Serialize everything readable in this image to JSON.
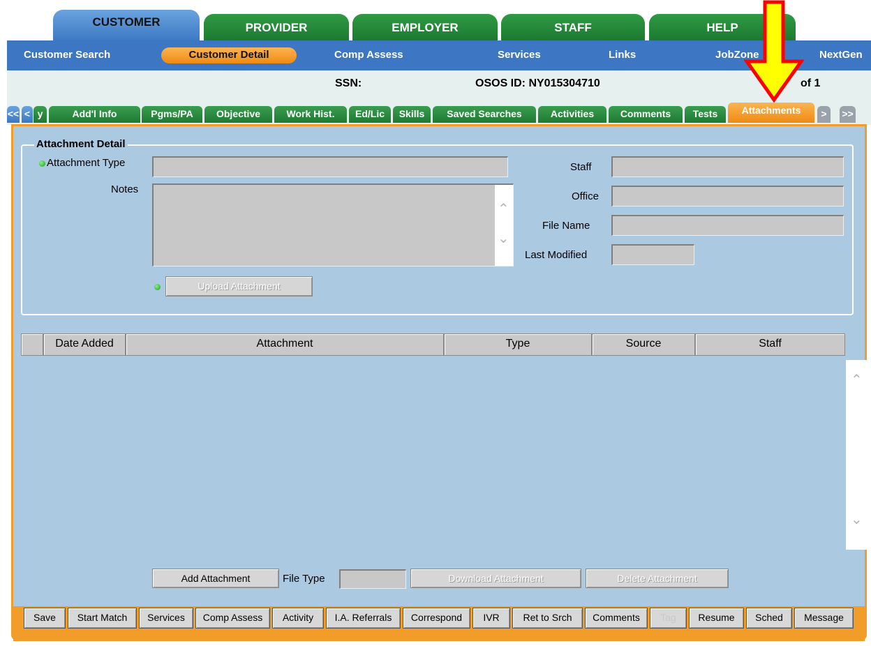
{
  "module_tabs": [
    "CUSTOMER",
    "PROVIDER",
    "EMPLOYER",
    "STAFF",
    "HELP"
  ],
  "subnav": {
    "items": [
      "Customer Search",
      "Customer Detail",
      "Comp Assess",
      "Services",
      "Links",
      "JobZone",
      "NextGen"
    ],
    "active": "Customer Detail"
  },
  "info": {
    "ssn_label": "SSN:",
    "osos_label": "OSOS ID: NY015304710",
    "of_label": "of 1"
  },
  "detail_tabs": {
    "nav_first": "<<",
    "nav_prev": "<",
    "partial": "y",
    "tabs": [
      "Add'l Info",
      "Pgms/PA",
      "Objective",
      "Work Hist.",
      "Ed/Lic",
      "Skills",
      "Saved Searches",
      "Activities",
      "Comments",
      "Tests",
      "Attachments"
    ],
    "active": "Attachments",
    "nav_next": ">",
    "nav_last": ">>"
  },
  "attachment_detail": {
    "legend": "Attachment Detail",
    "type_label": "Attachment Type",
    "notes_label": "Notes",
    "staff_label": "Staff",
    "office_label": "Office",
    "file_name_label": "File Name",
    "last_modified_label": "Last Modified",
    "upload_button": "Upload Attachment"
  },
  "table": {
    "columns": [
      "",
      "Date Added",
      "Attachment",
      "Type",
      "Source",
      "Staff"
    ],
    "rows": []
  },
  "actions": {
    "add_button": "Add Attachment",
    "file_type_label": "File Type",
    "download_button": "Download Attachment",
    "delete_button": "Delete Attachment"
  },
  "bottom_buttons": [
    "Save",
    "Start Match",
    "Services",
    "Comp Assess",
    "Activity",
    "I.A. Referrals",
    "Correspond",
    "IVR",
    "Ret to Srch",
    "Comments",
    "Tag",
    "Resume",
    "Sched",
    "Message"
  ],
  "colors": {
    "module_active": "#4a87cf",
    "module_green": "#22843a",
    "accent_orange": "#f29c2a",
    "panel_blue": "#acc9e2",
    "annotation_arrow": "#ffff00"
  },
  "icons": {
    "required_dot": "green-dot-icon",
    "annotation": "yellow-arrow-down-icon"
  }
}
